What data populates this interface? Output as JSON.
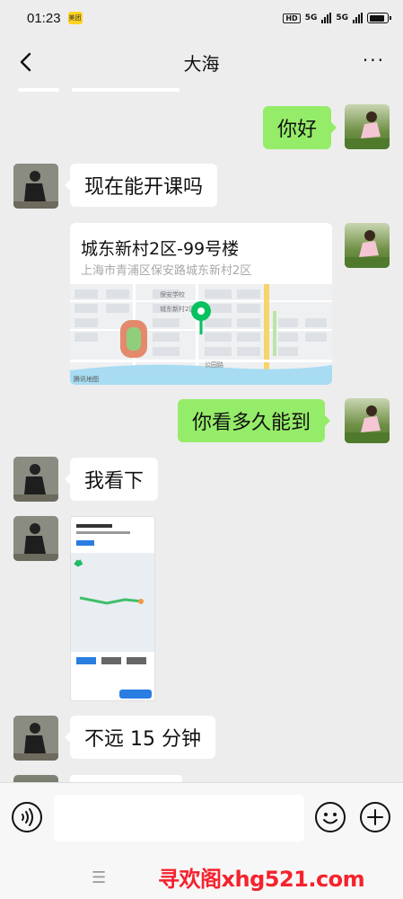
{
  "status_bar": {
    "time": "01:23",
    "app_badge": "美团",
    "hd": "HD",
    "net1": "5G",
    "net2": "5G"
  },
  "header": {
    "title": "大海",
    "more": "···"
  },
  "messages": [
    {
      "side": "right",
      "text": "你好"
    },
    {
      "side": "left",
      "text": "现在能开课吗"
    },
    {
      "side": "right",
      "type": "location",
      "name": "城东新村2区-99号楼",
      "address": "上海市青浦区保安路城东新村2区"
    },
    {
      "side": "right",
      "text": "你看多久能到"
    },
    {
      "side": "left",
      "text": "我看下"
    },
    {
      "side": "left",
      "type": "image",
      "icon": "map-screenshot"
    },
    {
      "side": "left",
      "text": "不远 15 分钟"
    }
  ],
  "map_labels": {
    "school": "保安学校",
    "park": "城东新村2区",
    "road": "公园路",
    "attribution": "腾讯地图"
  },
  "input": {
    "placeholder": ""
  },
  "watermark": "寻欢阁xhg521.com",
  "colors": {
    "sent_bubble": "#95ec69",
    "received_bubble": "#ffffff",
    "background": "#ededed",
    "pin": "#07c160"
  }
}
